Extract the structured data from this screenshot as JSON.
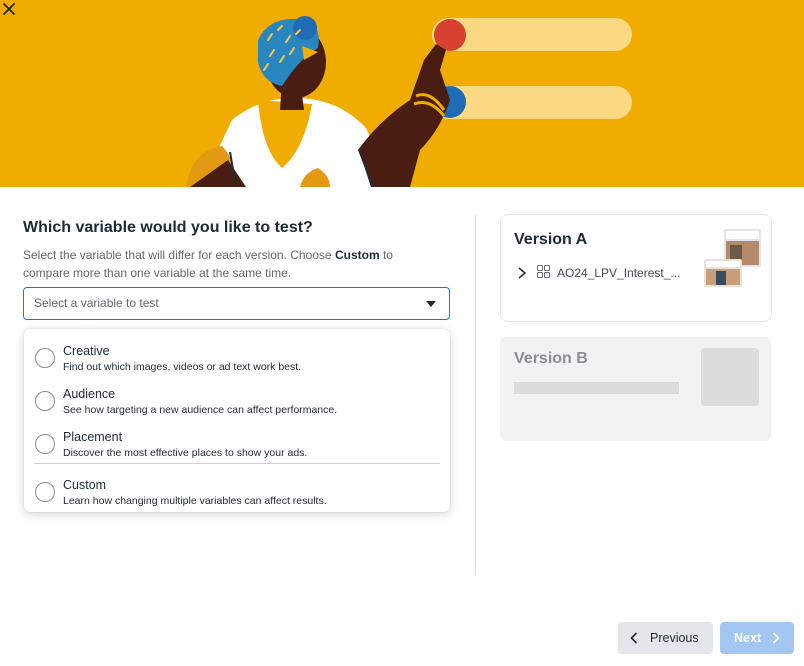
{
  "question": {
    "title": "Which variable would you like to test?",
    "desc_part1": "Select the variable that will differ for each version. Choose ",
    "desc_bold": "Custom",
    "desc_part2": " to compare more than one variable at the same time."
  },
  "select": {
    "placeholder": "Select a variable to test"
  },
  "options": [
    {
      "label": "Creative",
      "description": "Find out which images, videos or ad text work best."
    },
    {
      "label": "Audience",
      "description": "See how targeting a new audience can affect performance."
    },
    {
      "label": "Placement",
      "description": "Discover the most effective places to show your ads."
    },
    {
      "label": "Custom",
      "description": "Learn how changing multiple variables can affect results."
    }
  ],
  "version_a": {
    "title": "Version A",
    "ad_name": "AO24_LPV_Interest_..."
  },
  "version_b": {
    "title": "Version B"
  },
  "footer": {
    "previous_label": "Previous",
    "next_label": "Next"
  },
  "colors": {
    "banner": "#f0ac00",
    "accent": "#1b74e4",
    "next_disabled": "#a4c6f3"
  },
  "icons": {
    "close": "close-icon",
    "caret": "caret-down-icon",
    "chevron_right": "chevron-right-icon",
    "chevron_left": "chevron-left-icon",
    "grid": "grid-icon"
  }
}
